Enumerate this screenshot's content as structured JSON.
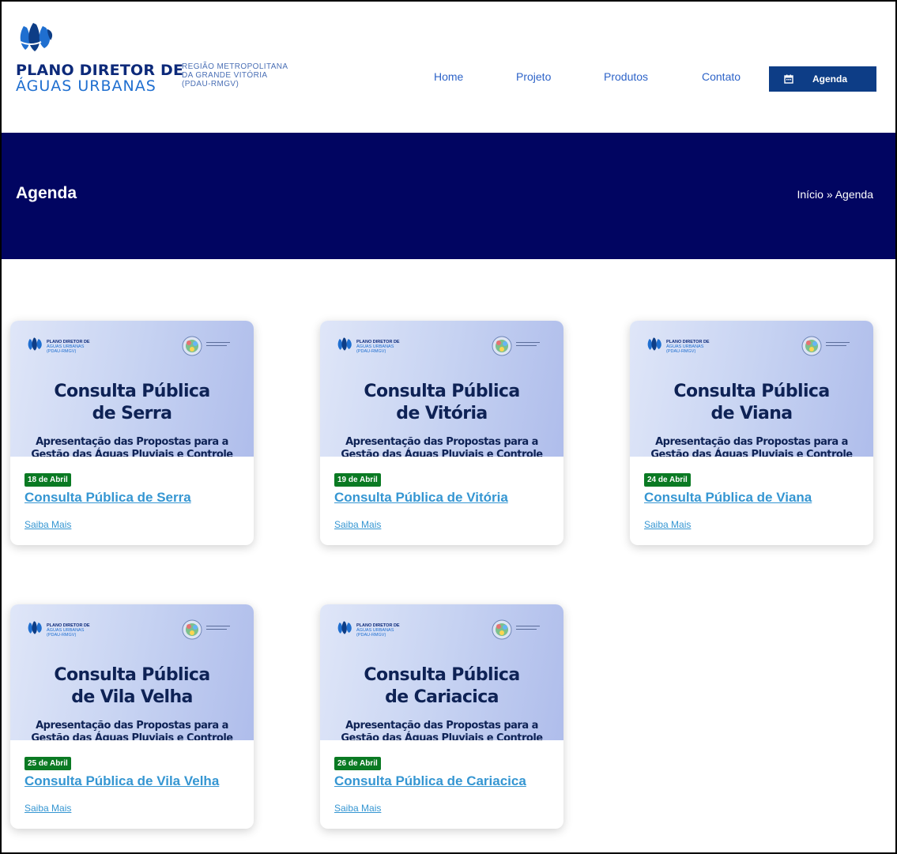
{
  "header": {
    "logo_line1": "PLANO DIRETOR DE",
    "logo_line2": "ÁGUAS URBANAS",
    "logo_sub": [
      "REGIÃO METROPOLITANA",
      "DA GRANDE VITÓRIA",
      "(PDAU-RMGV)"
    ],
    "nav": [
      "Home",
      "Projeto",
      "Produtos",
      "Contato"
    ],
    "agenda_button": "Agenda"
  },
  "banner": {
    "title": "Agenda",
    "breadcrumb": "Início » Agenda"
  },
  "cards": [
    {
      "title_line1": "Consulta Pública",
      "title_line2": "de Serra",
      "sub_line1": "Apresentação das Propostas para a",
      "sub_line2": "Gestão das Águas Pluviais e Controle",
      "date": "18 de Abril",
      "title": "Consulta Pública de Serra",
      "link": "Saiba Mais"
    },
    {
      "title_line1": "Consulta Pública",
      "title_line2": "de Vitória",
      "sub_line1": "Apresentação das Propostas para a",
      "sub_line2": "Gestão das Águas Pluviais e Controle",
      "date": "19 de Abril",
      "title": "Consulta Pública de Vitória",
      "link": "Saiba Mais"
    },
    {
      "title_line1": "Consulta Pública",
      "title_line2": "de Viana",
      "sub_line1": "Apresentação das Propostas para a",
      "sub_line2": "Gestão das Águas Pluviais e Controle",
      "date": "24 de Abril",
      "title": "Consulta Pública de Viana",
      "link": "Saiba Mais"
    },
    {
      "title_line1": "Consulta Pública",
      "title_line2": "de Vila Velha",
      "sub_line1": "Apresentação das Propostas para a",
      "sub_line2": "Gestão das Águas Pluviais e Controle",
      "date": "25 de Abril",
      "title": "Consulta Pública de Vila Velha",
      "link": "Saiba Mais"
    },
    {
      "title_line1": "Consulta Pública",
      "title_line2": "de Cariacica",
      "sub_line1": "Apresentação das Propostas para a",
      "sub_line2": "Gestão das Águas Pluviais e Controle",
      "date": "26 de Abril",
      "title": "Consulta Pública de Cariacica",
      "link": "Saiba Mais"
    }
  ],
  "thumb_logo": {
    "line1": "PLANO DIRETOR DE",
    "line2": "ÁGUAS URBANAS",
    "line3": "(PDAU-RMGV)"
  },
  "icons": {
    "logo": "water-drops-logo-icon",
    "agenda": "calendar-icon",
    "seal": "state-seal-icon"
  },
  "colors": {
    "banner": "#010561",
    "nav": "#2d63c8",
    "button": "#0d3d86",
    "badge": "#0a7a23",
    "card_title": "#3596d2",
    "logo_dark": "#0d2a7a",
    "logo_light": "#1f6fd0"
  }
}
